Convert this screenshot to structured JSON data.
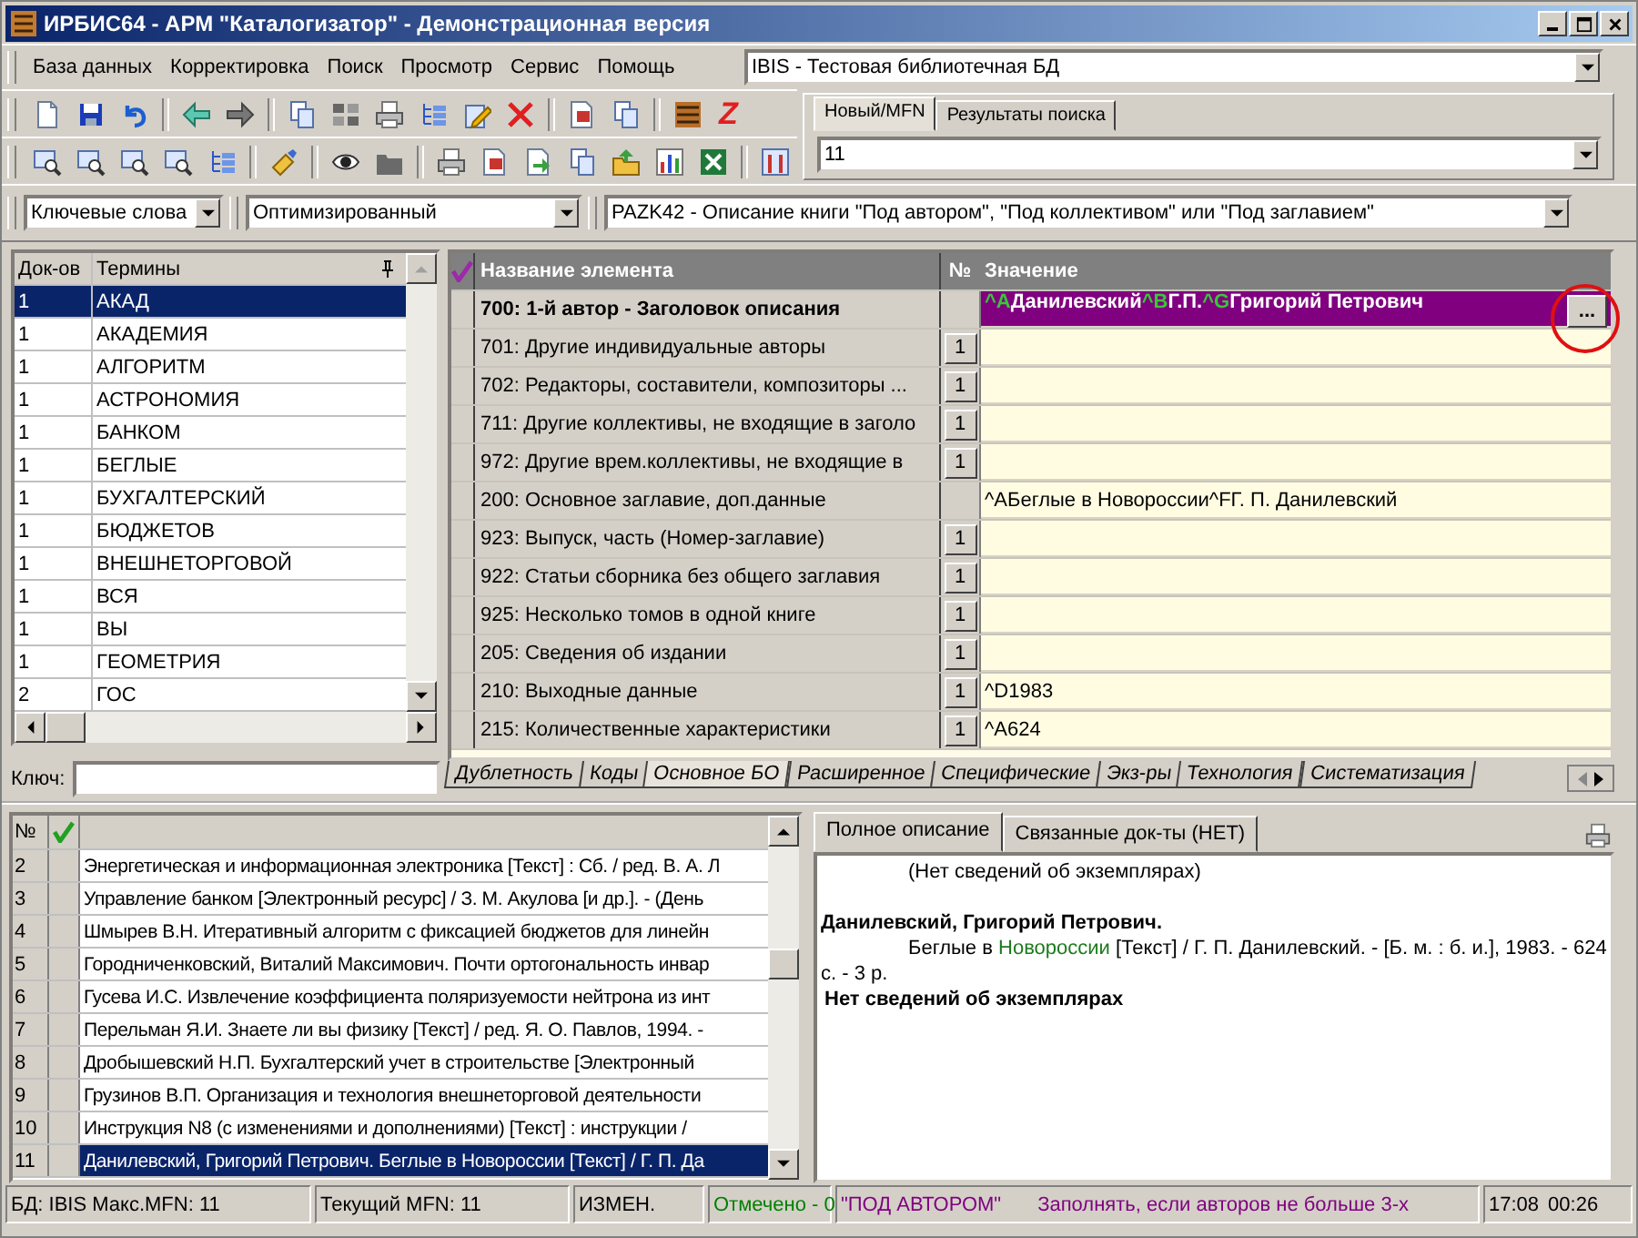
{
  "window": {
    "title": "ИРБИС64 - АРМ \"Каталогизатор\" - Демонстрационная версия"
  },
  "menu": [
    "База данных",
    "Корректировка",
    "Поиск",
    "Просмотр",
    "Сервис",
    "Помощь"
  ],
  "database_combo": {
    "value": "IBIS - Тестовая библиотечная БД"
  },
  "toolbar_letter": "Z",
  "record_tabs": [
    {
      "label": "Новый/MFN",
      "selected": true
    },
    {
      "label": "Результаты поиска",
      "selected": false
    }
  ],
  "mfn_combo": {
    "value": "11"
  },
  "search_mode_combo": {
    "value": "Ключевые слова"
  },
  "search_type_combo": {
    "value": "Оптимизированный"
  },
  "worksheet_combo": {
    "value": "PAZK42 - Описание книги \"Под автором\", \"Под коллективом\" или \"Под заглавием\""
  },
  "terms": {
    "columns": [
      "Док-ов",
      "Термины"
    ],
    "rows": [
      {
        "count": "1",
        "term": "АКАД",
        "selected": true
      },
      {
        "count": "1",
        "term": "АКАДЕМИЯ",
        "selected": false
      },
      {
        "count": "1",
        "term": "АЛГОРИТМ",
        "selected": false
      },
      {
        "count": "1",
        "term": "АСТРОНОМИЯ",
        "selected": false
      },
      {
        "count": "1",
        "term": "БАНКОМ",
        "selected": false
      },
      {
        "count": "1",
        "term": "БЕГЛЫЕ",
        "selected": false
      },
      {
        "count": "1",
        "term": "БУХГАЛТЕРСКИЙ",
        "selected": false
      },
      {
        "count": "1",
        "term": "БЮДЖЕТОВ",
        "selected": false
      },
      {
        "count": "1",
        "term": "ВНЕШНЕТОРГОВОЙ",
        "selected": false
      },
      {
        "count": "1",
        "term": "ВСЯ",
        "selected": false
      },
      {
        "count": "1",
        "term": "ВЫ",
        "selected": false
      },
      {
        "count": "1",
        "term": "ГЕОМЕТРИЯ",
        "selected": false
      },
      {
        "count": "2",
        "term": "ГОС",
        "selected": false
      }
    ]
  },
  "key_field": {
    "label": "Ключ:"
  },
  "fields_grid": {
    "columns": [
      "Название элемента",
      "№",
      "Значение"
    ],
    "rows": [
      {
        "name": "700: 1-й автор - Заголовок описания",
        "number": "",
        "selected": true,
        "edit_button": "...",
        "value_parts": [
          {
            "text": "^A",
            "kind": "code"
          },
          {
            "text": "Данилевский",
            "kind": "text"
          },
          {
            "text": "^B",
            "kind": "code"
          },
          {
            "text": "Г.П.",
            "kind": "text"
          },
          {
            "text": "^G",
            "kind": "code"
          },
          {
            "text": "Григорий Петрович",
            "kind": "text"
          }
        ]
      },
      {
        "name": "701: Другие индивидуальные авторы",
        "number": "1",
        "selected": false
      },
      {
        "name": "702: Редакторы, составители, композиторы ...",
        "number": "1",
        "selected": false
      },
      {
        "name": "711: Другие коллективы, не входящие в заголо",
        "number": "1",
        "selected": false
      },
      {
        "name": "972: Другие врем.коллективы, не входящие в",
        "number": "1",
        "selected": false
      },
      {
        "name": "200: Основное заглавие, доп.данные",
        "number": "",
        "selected": false,
        "value": "^AБеглые в Новороссии^FГ. П. Данилевский"
      },
      {
        "name": "923: Выпуск, часть (Номер-заглавие)",
        "number": "1",
        "selected": false
      },
      {
        "name": "922: Статьи сборника без общего заглавия",
        "number": "1",
        "selected": false
      },
      {
        "name": "925: Несколько томов в одной книге",
        "number": "1",
        "selected": false
      },
      {
        "name": "205: Сведения об издании",
        "number": "1",
        "selected": false
      },
      {
        "name": "210: Выходные данные",
        "number": "1",
        "selected": false,
        "value": "^D1983"
      },
      {
        "name": "215: Количественные характеристики",
        "number": "1",
        "selected": false,
        "value": "^A624"
      }
    ]
  },
  "grid_tabs": [
    {
      "label": "Дублетность",
      "selected": false
    },
    {
      "label": "Коды",
      "selected": false
    },
    {
      "label": "Основное БО",
      "selected": true
    },
    {
      "label": "Расширенное",
      "selected": false
    },
    {
      "label": "Специфические",
      "selected": false
    },
    {
      "label": "Экз-ры",
      "selected": false
    },
    {
      "label": "Технология",
      "selected": false
    },
    {
      "label": "Систематизация",
      "selected": false
    }
  ],
  "records": {
    "number_column": "№",
    "rows": [
      {
        "number": "2",
        "text": "Энергетическая и информационная электроника [Текст] : Сб. / ред. В. А. Л",
        "selected": false
      },
      {
        "number": "3",
        "text": "Управление банком [Электронный ресурс]  / З. М. Акулова [и др.]. - (День",
        "selected": false
      },
      {
        "number": "4",
        "text": "Шмырев В.Н. Итеративный алгоритм с фиксацией бюджетов для линейн",
        "selected": false
      },
      {
        "number": "5",
        "text": "Городниченковский, Виталий Максимович. Почти ортогональность инвар",
        "selected": false
      },
      {
        "number": "6",
        "text": "Гусева И.С. Извлечение коэффициента поляризуемости нейтрона из инт",
        "selected": false
      },
      {
        "number": "7",
        "text": "Перельман Я.И. Знаете ли вы физику [Текст] / ред. Я. О. Павлов, 1994. -",
        "selected": false
      },
      {
        "number": "8",
        "text": "Дробышевский Н.П. Бухгалтерский учет в строительстве [Электронный",
        "selected": false
      },
      {
        "number": "9",
        "text": "Грузинов В.П. Организация и технология внешнеторговой деятельности",
        "selected": false
      },
      {
        "number": "10",
        "text": "Инструкция N8   (с изменениями и дополнениями) [Текст] : инструкции /",
        "selected": false
      },
      {
        "number": "11",
        "text": "Данилевский, Григорий Петрович. Беглые в Новороссии [Текст] / Г. П. Да",
        "selected": true
      }
    ]
  },
  "description_tabs": [
    {
      "label": "Полное описание",
      "selected": true
    },
    {
      "label": "Связанные док-ты (НЕТ)",
      "selected": false
    }
  ],
  "description": {
    "note": "(Нет сведений об экземплярах)",
    "heading": "Данилевский, Григорий Петрович.",
    "body_before": "Беглые в ",
    "body_link": "Новороссии",
    "body_after": " [Текст] / Г. П. Данилевский. - [Б. м. : б. и.], 1983. - 624 с. - 3 р.",
    "footer": "Нет сведений об экземплярах"
  },
  "status_bar": [
    {
      "items": [
        {
          "text": "БД: IBIS Макс.MFN: 11",
          "color": "#000000"
        }
      ]
    },
    {
      "items": [
        {
          "text": "Текущий MFN: 11",
          "color": "#000000"
        }
      ]
    },
    {
      "items": [
        {
          "text": "ИЗМЕН.",
          "color": "#000000"
        }
      ]
    },
    {
      "items": [
        {
          "text": "Отмечено - 0",
          "color": "#008000"
        }
      ]
    },
    {
      "items": [
        {
          "text": "\"ПОД АВТОРОМ\"",
          "color": "#800080"
        },
        {
          "text": "Заполнять, если авторов не больше 3-х",
          "color": "#800080"
        }
      ]
    },
    {
      "items": [
        {
          "text": "17:08",
          "color": "#000000"
        },
        {
          "text": "00:26",
          "color": "#000000"
        }
      ]
    }
  ]
}
